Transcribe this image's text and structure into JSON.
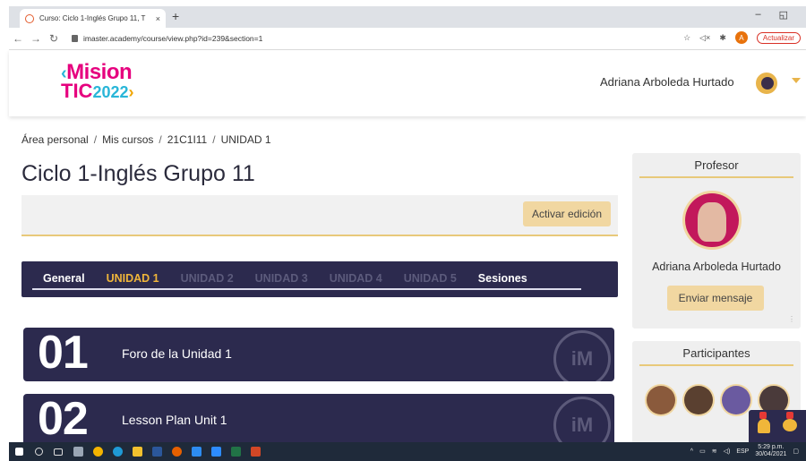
{
  "browser": {
    "tab_title": "Curso: Ciclo 1-Inglés Grupo 11, T",
    "tab_close": "×",
    "new_tab": "+",
    "min": "–",
    "restore": "◱",
    "url": "imaster.academy/course/view.php?id=239&section=1",
    "profile_initial": "A",
    "update_label": "Actualizar"
  },
  "header": {
    "logo_line1": "Mision",
    "logo_tic": "TIC",
    "logo_year": "2022",
    "user_name": "Adriana Arboleda Hurtado"
  },
  "breadcrumb": {
    "items": [
      "Área personal",
      "Mis cursos",
      "21C1I11",
      "UNIDAD 1"
    ],
    "separator": "/"
  },
  "page": {
    "title": "Ciclo 1-Inglés Grupo 11",
    "edit_button": "Activar edición"
  },
  "units": {
    "tabs": [
      "General",
      "UNIDAD 1",
      "UNIDAD 2",
      "UNIDAD 3",
      "UNIDAD 4",
      "UNIDAD 5",
      "Sesiones"
    ]
  },
  "sections": [
    {
      "number": "01",
      "title": "Foro de la Unidad 1",
      "watermark": "iM"
    },
    {
      "number": "02",
      "title": "Lesson Plan Unit 1",
      "watermark": "iM"
    }
  ],
  "teacher_block": {
    "heading": "Profesor",
    "name": "Adriana Arboleda Hurtado",
    "message_button": "Enviar mensaje"
  },
  "participants_block": {
    "heading": "Participantes"
  },
  "taskbar": {
    "lang": "ESP",
    "time": "5:29 p.m.",
    "date": "30/04/2021"
  },
  "colors": {
    "navy": "#2c2a4e",
    "gold": "#f0b63a",
    "button": "#f1d7a1"
  }
}
